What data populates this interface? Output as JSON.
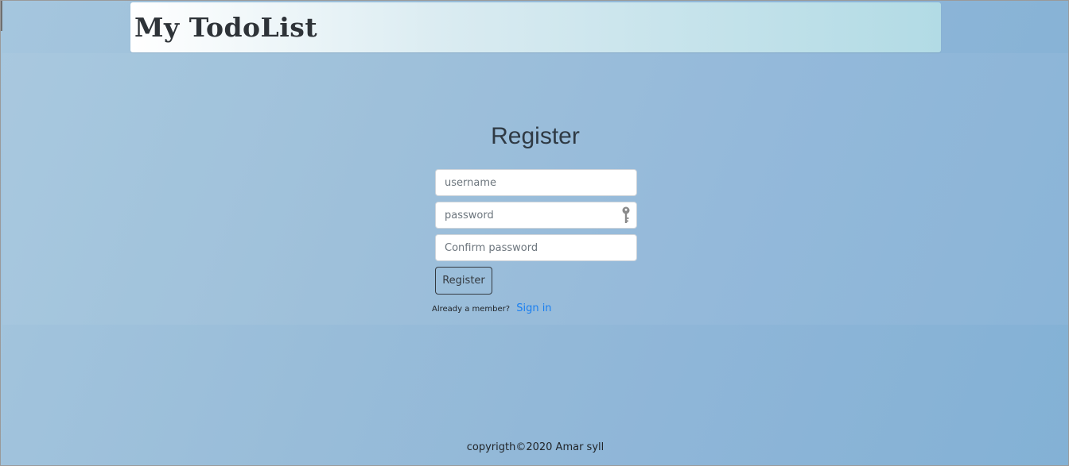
{
  "header": {
    "brand": "My TodoList"
  },
  "form": {
    "title": "Register",
    "username_placeholder": "username",
    "password_placeholder": "password",
    "confirm_placeholder": "Confirm password",
    "password_icon": "key-icon",
    "submit_label": "Register",
    "member_text": "Already a member?",
    "signin_label": "Sign in"
  },
  "footer": {
    "text": "copyrigth©2020 Amar syll"
  },
  "colors": {
    "link": "#1a7ff0",
    "text": "#2e3338",
    "background": "#99bdd9"
  }
}
